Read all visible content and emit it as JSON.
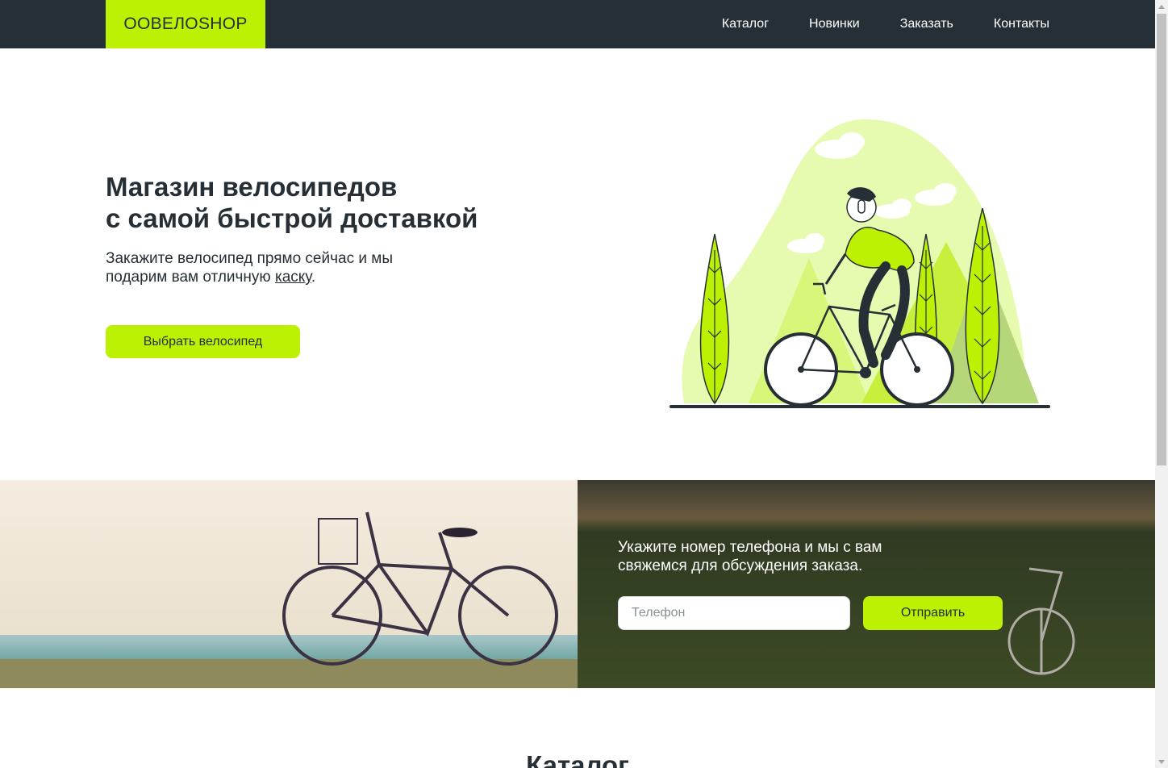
{
  "header": {
    "logo": "OOВЕЛОSHOP",
    "nav": [
      "Каталог",
      "Новинки",
      "Заказать",
      "Контакты"
    ]
  },
  "hero": {
    "title_line1": "Магазин велосипедов",
    "title_line2": "с самой быстрой доставкой",
    "subtitle_before": "Закажите велосипед прямо сейчас и мы подарим вам отличную ",
    "subtitle_link": "каску",
    "subtitle_after": ".",
    "button": "Выбрать велосипед"
  },
  "callback": {
    "text": "Укажите номер телефона и мы с вам свяжемся для обсуждения заказа.",
    "phone_placeholder": "Телефон",
    "phone_value": "",
    "button": "Отправить"
  },
  "catalog": {
    "title": "Каталог"
  },
  "colors": {
    "accent": "#bdf104",
    "dark": "#262f35",
    "white": "#ffffff"
  },
  "icons": [
    "scroll-up-arrow-icon",
    "scroll-down-arrow-icon"
  ]
}
